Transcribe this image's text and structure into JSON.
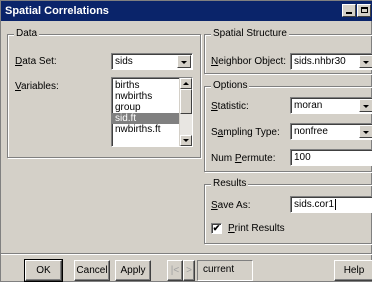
{
  "window": {
    "title": "Spatial Correlations"
  },
  "data_group": {
    "legend": "Data",
    "dataset_label_u": "D",
    "dataset_label_rest": "ata Set:",
    "dataset_value": "sids",
    "variables_label_u": "V",
    "variables_label_rest": "ariables:",
    "variables": [
      "births",
      "nwbirths",
      "group",
      "sid.ft",
      "nwbirths.ft"
    ],
    "selected_variable_index": 3
  },
  "structure_group": {
    "legend": "Spatial Structure",
    "neighbor_label_u": "N",
    "neighbor_label_rest": "eighbor Object:",
    "neighbor_value": "sids.nhbr30"
  },
  "options_group": {
    "legend": "Options",
    "statistic_label_u": "S",
    "statistic_label_rest": "tatistic:",
    "statistic_value": "moran",
    "sampling_label_pre": "S",
    "sampling_label_u": "a",
    "sampling_label_rest": "mpling Type:",
    "sampling_value": "nonfree",
    "permute_label_pre": "Num ",
    "permute_label_u": "P",
    "permute_label_rest": "ermute:",
    "permute_value": "100"
  },
  "results_group": {
    "legend": "Results",
    "saveas_label_u": "S",
    "saveas_label_rest": "ave As:",
    "saveas_value": "sids.cor1",
    "print_label_u": "P",
    "print_label_rest": "rint Results",
    "print_checked": true,
    "check_mark": "✔"
  },
  "buttons": {
    "ok": "OK",
    "cancel": "Cancel",
    "apply": "Apply",
    "prev": "|<",
    "next": ">",
    "current": "current",
    "help": "Help"
  }
}
